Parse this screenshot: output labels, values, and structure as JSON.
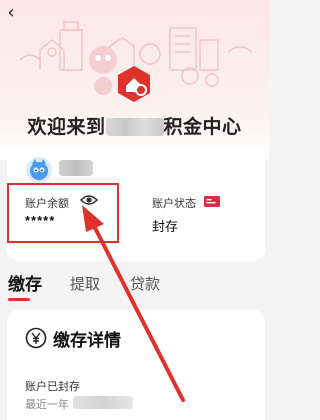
{
  "header": {
    "back_icon": "chevron-left-icon",
    "welcome_prefix": "欢迎来到",
    "welcome_suffix": "积金中心"
  },
  "account": {
    "balance_label": "账户余额",
    "balance_value": "*****",
    "status_label": "账户状态",
    "status_value": "封存"
  },
  "tabs": [
    {
      "label": "缴存"
    },
    {
      "label": "提取"
    },
    {
      "label": "贷款"
    }
  ],
  "detail": {
    "title": "缴存详情",
    "sealed_text": "账户已封存",
    "last_year_prefix": "最近一年"
  },
  "colors": {
    "accent": "#e0322c",
    "hero_bg": "#fbe6e6"
  }
}
